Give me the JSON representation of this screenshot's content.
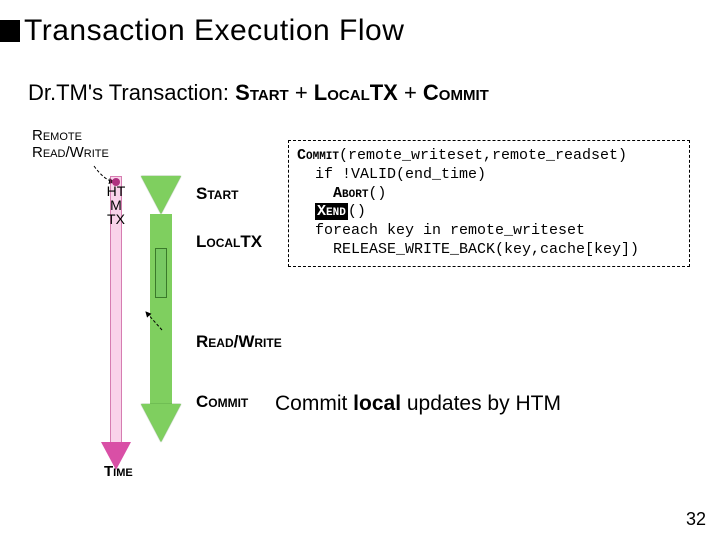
{
  "title": "Transaction Execution Flow",
  "subtitle_prefix": "Dr.TM's Transaction: ",
  "subtitle_parts": {
    "start": "Start",
    "plus1": " + ",
    "localtx": "LocalTX",
    "plus2": " + ",
    "commit": "Commit"
  },
  "remote_label_line1": "Remote",
  "remote_label_line2": "Read/Write",
  "htm_label": "HT\nM\nTX",
  "phases": {
    "start": "Start",
    "localtx": "LocalTX",
    "readwrite": "Read/Write",
    "commit": "Commit"
  },
  "time_label": "Time",
  "code": {
    "l1_kw": "Commit",
    "l1_rest": "(remote_writeset,remote_readset)",
    "l2": "  if !VALID(end_time)",
    "l3_kw": "Abort",
    "l3_rest": "()",
    "l4_kw": "Xend",
    "l4_rest": "()",
    "l5": "  foreach key in remote_writeset",
    "l6": "    RELEASE_WRITE_BACK(key,cache[key])"
  },
  "commit_note_prefix": "Commit ",
  "commit_note_bold": "local",
  "commit_note_suffix": " updates by HTM",
  "slide_number": "32"
}
